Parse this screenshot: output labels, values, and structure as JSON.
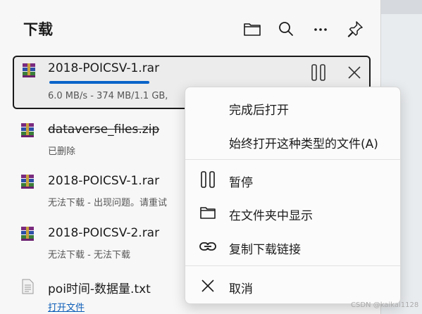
{
  "header": {
    "title": "下载",
    "icons": [
      "folder-icon",
      "search-icon",
      "more-icon",
      "pin-icon"
    ]
  },
  "downloads": [
    {
      "name": "2018-POICSV-1.rar",
      "status": "6.0 MB/s - 374 MB/1.1 GB, ",
      "progress": 0.33,
      "icon": "rar-archive-icon",
      "active": true
    },
    {
      "name": "dataverse_files.zip",
      "status": "已删除",
      "icon": "rar-archive-icon",
      "deleted": true
    },
    {
      "name": "2018-POICSV-1.rar",
      "status": "无法下载 - 出现问题。请重试",
      "icon": "rar-archive-icon"
    },
    {
      "name": "2018-POICSV-2.rar",
      "status": "无法下载 - 无法下载",
      "icon": "rar-archive-icon"
    },
    {
      "name": "poi时间-数据量.txt",
      "status": "打开文件",
      "icon": "text-file-icon"
    }
  ],
  "context_menu": {
    "items": [
      {
        "label": "完成后打开",
        "icon": ""
      },
      {
        "label": "始终打开这种类型的文件(A)",
        "icon": ""
      },
      {
        "label": "暂停",
        "icon": "pause-icon"
      },
      {
        "label": "在文件夹中显示",
        "icon": "folder-icon"
      },
      {
        "label": "复制下载链接",
        "icon": "link-icon"
      },
      {
        "label": "取消",
        "icon": "close-icon"
      }
    ]
  },
  "watermark": "CSDN @kaikai1128",
  "colors": {
    "accent": "#0b64c9",
    "link": "#0d5eb8"
  }
}
